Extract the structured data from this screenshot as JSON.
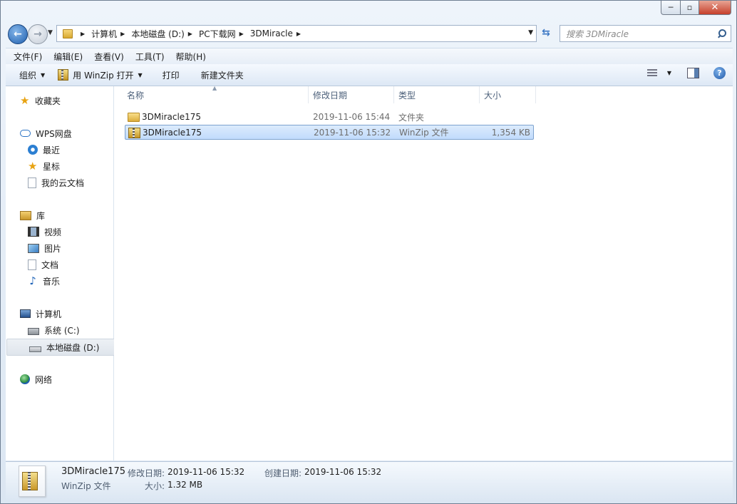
{
  "window": {
    "min": "─",
    "max": "▫",
    "close": "✕"
  },
  "address": {
    "crumbs": [
      "计算机",
      "本地磁盘 (D:)",
      "PC下载网",
      "3DMiracle"
    ]
  },
  "search": {
    "placeholder": "搜索 3DMiracle"
  },
  "menu": [
    "文件(F)",
    "编辑(E)",
    "查看(V)",
    "工具(T)",
    "帮助(H)"
  ],
  "toolbar": {
    "organize": "组织",
    "open_with": "用 WinZip 打开",
    "print": "打印",
    "new_folder": "新建文件夹",
    "help": "?"
  },
  "sidebar": {
    "favorites": "收藏夹",
    "wps": "WPS网盘",
    "recent": "最近",
    "starred": "星标",
    "my_cloud_docs": "我的云文档",
    "libraries": "库",
    "videos": "视频",
    "pictures": "图片",
    "documents": "文档",
    "music": "音乐",
    "computer": "计算机",
    "drive_c": "系统 (C:)",
    "drive_d": "本地磁盘 (D:)",
    "network": "网络"
  },
  "columns": [
    "名称",
    "修改日期",
    "类型",
    "大小"
  ],
  "files": [
    {
      "name": "3DMiracle175",
      "date": "2019-11-06 15:44",
      "type": "文件夹",
      "size": "",
      "icon": "folder-icon"
    },
    {
      "name": "3DMiracle175",
      "date": "2019-11-06 15:32",
      "type": "WinZip 文件",
      "size": "1,354 KB",
      "icon": "zip-file-icon"
    }
  ],
  "details": {
    "name": "3DMiracle175",
    "type": "WinZip 文件",
    "modified_label": "修改日期:",
    "modified": "2019-11-06 15:32",
    "created_label": "创建日期:",
    "created": "2019-11-06 15:32",
    "size_label": "大小:",
    "size": "1.32 MB"
  }
}
